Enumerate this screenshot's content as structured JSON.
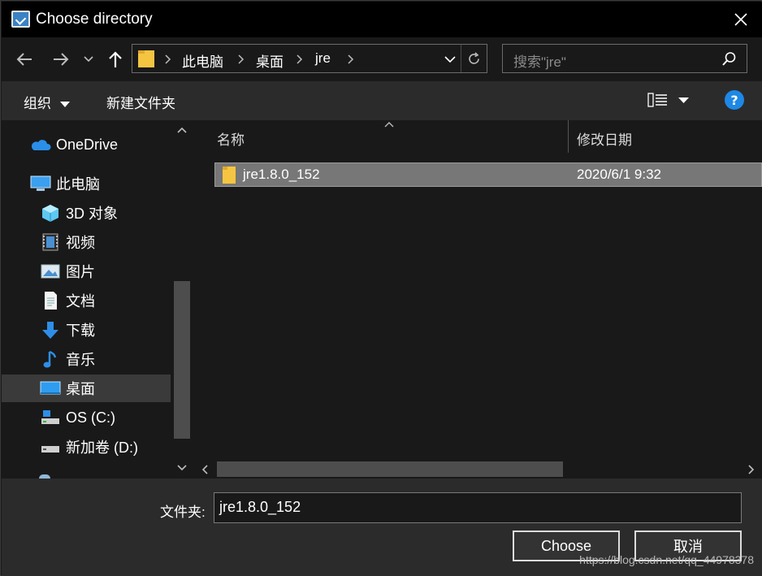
{
  "window": {
    "title": "Choose directory"
  },
  "nav": {
    "breadcrumbs": [
      "此电脑",
      "桌面",
      "jre"
    ],
    "search_placeholder": "搜索\"jre\""
  },
  "toolbar": {
    "organize": "组织",
    "new_folder": "新建文件夹"
  },
  "sidebar": {
    "items": [
      {
        "label": "OneDrive",
        "icon": "onedrive-icon"
      },
      {
        "label": "此电脑",
        "icon": "computer-icon"
      },
      {
        "label": "3D 对象",
        "icon": "3d-objects-icon"
      },
      {
        "label": "视频",
        "icon": "video-icon"
      },
      {
        "label": "图片",
        "icon": "pictures-icon"
      },
      {
        "label": "文档",
        "icon": "documents-icon"
      },
      {
        "label": "下载",
        "icon": "download-icon"
      },
      {
        "label": "音乐",
        "icon": "music-icon"
      },
      {
        "label": "桌面",
        "icon": "desktop-icon",
        "selected": true
      },
      {
        "label": "OS (C:)",
        "icon": "drive-c-icon"
      },
      {
        "label": "新加卷 (D:)",
        "icon": "drive-d-icon"
      }
    ]
  },
  "list": {
    "columns": {
      "name": "名称",
      "modified": "修改日期"
    },
    "rows": [
      {
        "name": "jre1.8.0_152",
        "modified": "2020/6/1 9:32"
      }
    ]
  },
  "footer": {
    "folder_label": "文件夹:",
    "folder_value": "jre1.8.0_152",
    "choose": "Choose",
    "cancel": "取消"
  },
  "watermark": "https://blog.csdn.net/qq_44978378",
  "colors": {
    "background": "#191919",
    "selection": "#777777",
    "help": "#1e88e5",
    "folder": "#f5c542"
  }
}
